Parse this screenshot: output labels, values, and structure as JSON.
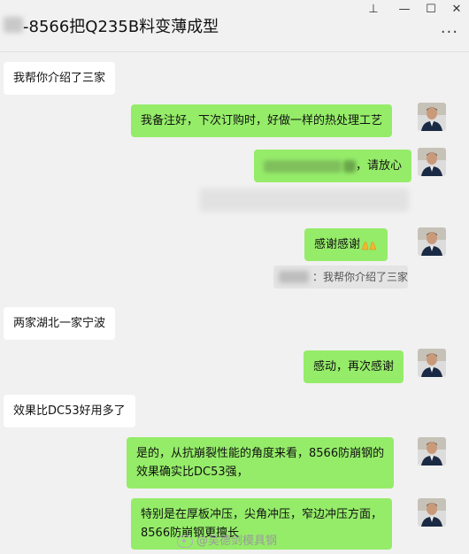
{
  "window": {
    "title": "-8566把Q235B料变薄成型",
    "pin_glyph": "⊥",
    "minimize_glyph": "—",
    "maximize_glyph": "☐",
    "close_glyph": "✕",
    "more_glyph": "···"
  },
  "messages": [
    {
      "side": "left",
      "text": "我帮你介绍了三家"
    },
    {
      "side": "right",
      "text": "我备注好，下次订购时，好做一样的热处理工艺"
    },
    {
      "side": "right",
      "text_suffix": "，请放心"
    },
    {
      "side": "right",
      "text": "感谢感谢",
      "emoji": "praying-hands"
    },
    {
      "side": "quote",
      "text": "：我帮你介绍了三家"
    },
    {
      "side": "left",
      "text": "两家湖北一家宁波"
    },
    {
      "side": "right",
      "text": "感动，再次感谢"
    },
    {
      "side": "left",
      "text": "效果比DC53好用多了"
    },
    {
      "side": "right",
      "line1": "是的，从抗崩裂性能的角度来看，8566防崩钢的",
      "line2": "效果确实比DC53强，"
    },
    {
      "side": "right",
      "line1": "特别是在厚板冲压，尖角冲压，窄边冲压方面，",
      "line2": "8566防崩钢更擅长"
    }
  ],
  "watermark": "@吴德剑模具钢",
  "colors": {
    "self_bubble": "#95ec69",
    "other_bubble": "#ffffff",
    "background": "#f1f1f1"
  }
}
